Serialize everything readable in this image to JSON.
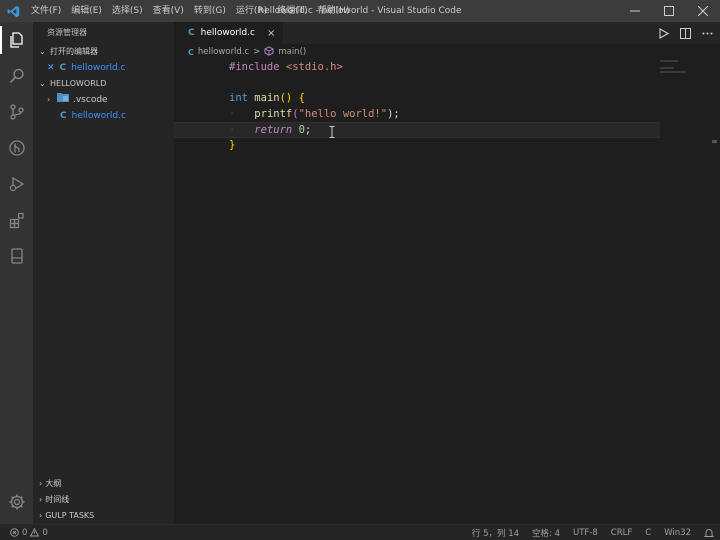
{
  "window": {
    "title": "helloworld.c - helloworld - Visual Studio Code",
    "accent": "#0078d4"
  },
  "menu": [
    "文件(F)",
    "编辑(E)",
    "选择(S)",
    "查看(V)",
    "转到(G)",
    "运行(R)",
    "终端(T)",
    "帮助(H)"
  ],
  "activity_bar": [
    "explorer-icon",
    "search-icon",
    "source-control-icon",
    "git-graph-icon",
    "run-debug-icon",
    "extensions-icon",
    "remote-explorer-icon",
    "settings-gear-icon"
  ],
  "sidebar": {
    "title": "资源管理器",
    "open_editors": {
      "header": "打开的编辑器",
      "items": [
        {
          "name": "helloworld.c",
          "icon": "C"
        }
      ]
    },
    "folder": {
      "header": "HELLOWORLD",
      "items": [
        {
          "name": ".vscode",
          "type": "folder"
        },
        {
          "name": "helloworld.c",
          "type": "file",
          "icon": "C"
        }
      ]
    },
    "bottom_sections": [
      "大纲",
      "时间线",
      "GULP TASKS"
    ]
  },
  "editor": {
    "tab": {
      "label": "helloworld.c",
      "icon": "C",
      "close": "×"
    },
    "breadcrumb": {
      "file": "helloworld.c",
      "separator": ">",
      "symbol": "main()"
    },
    "code": {
      "l1": {
        "directive": "#include",
        "header": "<stdio.h>"
      },
      "l3": {
        "type": "int",
        "fn": "main",
        "parens": "()",
        "brace": "{"
      },
      "l4": {
        "fn": "printf",
        "open": "(",
        "str": "\"hello world!\"",
        "close": ");"
      },
      "l5": {
        "kw": "return",
        "num": "0",
        "semi": ";"
      },
      "l6": {
        "brace": "}"
      }
    }
  },
  "status_bar": {
    "errors": "0",
    "warnings": "0",
    "position": "行 5，列 14",
    "spaces": "空格: 4",
    "encoding": "UTF-8",
    "eol": "CRLF",
    "language": "C",
    "platform": "Win32"
  }
}
